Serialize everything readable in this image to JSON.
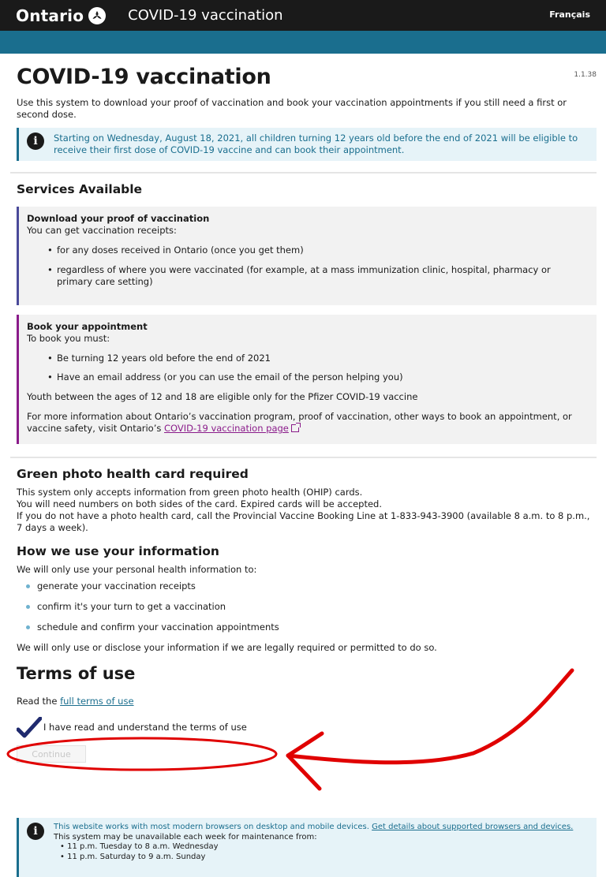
{
  "header": {
    "brand": "Ontario",
    "app_title": "COVID-19 vaccination",
    "language_link": "Français"
  },
  "page": {
    "title": "COVID-19 vaccination",
    "version": "1.1.38",
    "intro": "Use this system to download your proof of vaccination and book your vaccination appointments if you still need a first or second dose.",
    "notice": "Starting on Wednesday, August 18, 2021, all children turning 12 years old before the end of 2021 will be eligible to receive their first dose of COVID-19 vaccine and can book their appointment."
  },
  "services": {
    "heading": "Services Available",
    "proof": {
      "title": "Download your proof of vaccination",
      "subtitle": "You can get vaccination receipts:",
      "items": [
        "for any doses received in Ontario (once you get them)",
        "regardless of where you were vaccinated (for example, at a mass immunization clinic, hospital, pharmacy or primary care setting)"
      ]
    },
    "book": {
      "title": "Book your appointment",
      "subtitle": "To book you must:",
      "items": [
        "Be turning 12 years old before the end of 2021",
        "Have an email address (or you can use the email of the person helping you)"
      ],
      "youth_note": "Youth between the ages of 12 and 18 are eligible only for the Pfizer COVID-19 vaccine",
      "more_info_prefix": "For more information about Ontario’s vaccination program, proof of vaccination, other ways to book an appointment, or vaccine safety, visit Ontario’s ",
      "more_info_link": "COVID-19 vaccination page"
    }
  },
  "health_card": {
    "heading": "Green photo health card required",
    "lines": [
      "This system only accepts information from green photo health (OHIP) cards.",
      "You will need numbers on both sides of the card. Expired cards will be accepted.",
      "If you do not have a photo health card, call the Provincial Vaccine Booking Line at 1-833-943-3900 (available 8 a.m. to 8 p.m., 7 days a week)."
    ]
  },
  "info_use": {
    "heading": "How we use your information",
    "intro": "We will only use your personal health information to:",
    "items": [
      "generate your vaccination receipts",
      "confirm it's your turn to get a vaccination",
      "schedule and confirm your vaccination appointments"
    ],
    "closing": "We will only use or disclose your information if we are legally required or permitted to do so."
  },
  "terms": {
    "heading": "Terms of use",
    "read_prefix": "Read the ",
    "read_link": "full terms of use",
    "checkbox_label": "I have read and understand the terms of use",
    "continue_label": "Continue"
  },
  "footer": {
    "browser_text": "This website works with most modern browsers on desktop and mobile devices. ",
    "browser_link": "Get details about supported browsers and devices.",
    "maintenance": "This system may be unavailable each week for maintenance from:",
    "windows": [
      "11 p.m. Tuesday to 8 a.m. Wednesday",
      "11 p.m. Saturday to 9 a.m. Sunday"
    ]
  },
  "colors": {
    "header_bg": "#1a1a1a",
    "accent_blue": "#1a6e8e",
    "link_purple": "#8a1b8a",
    "annotation_red": "#e00000",
    "check_navy": "#1f2a6e"
  }
}
